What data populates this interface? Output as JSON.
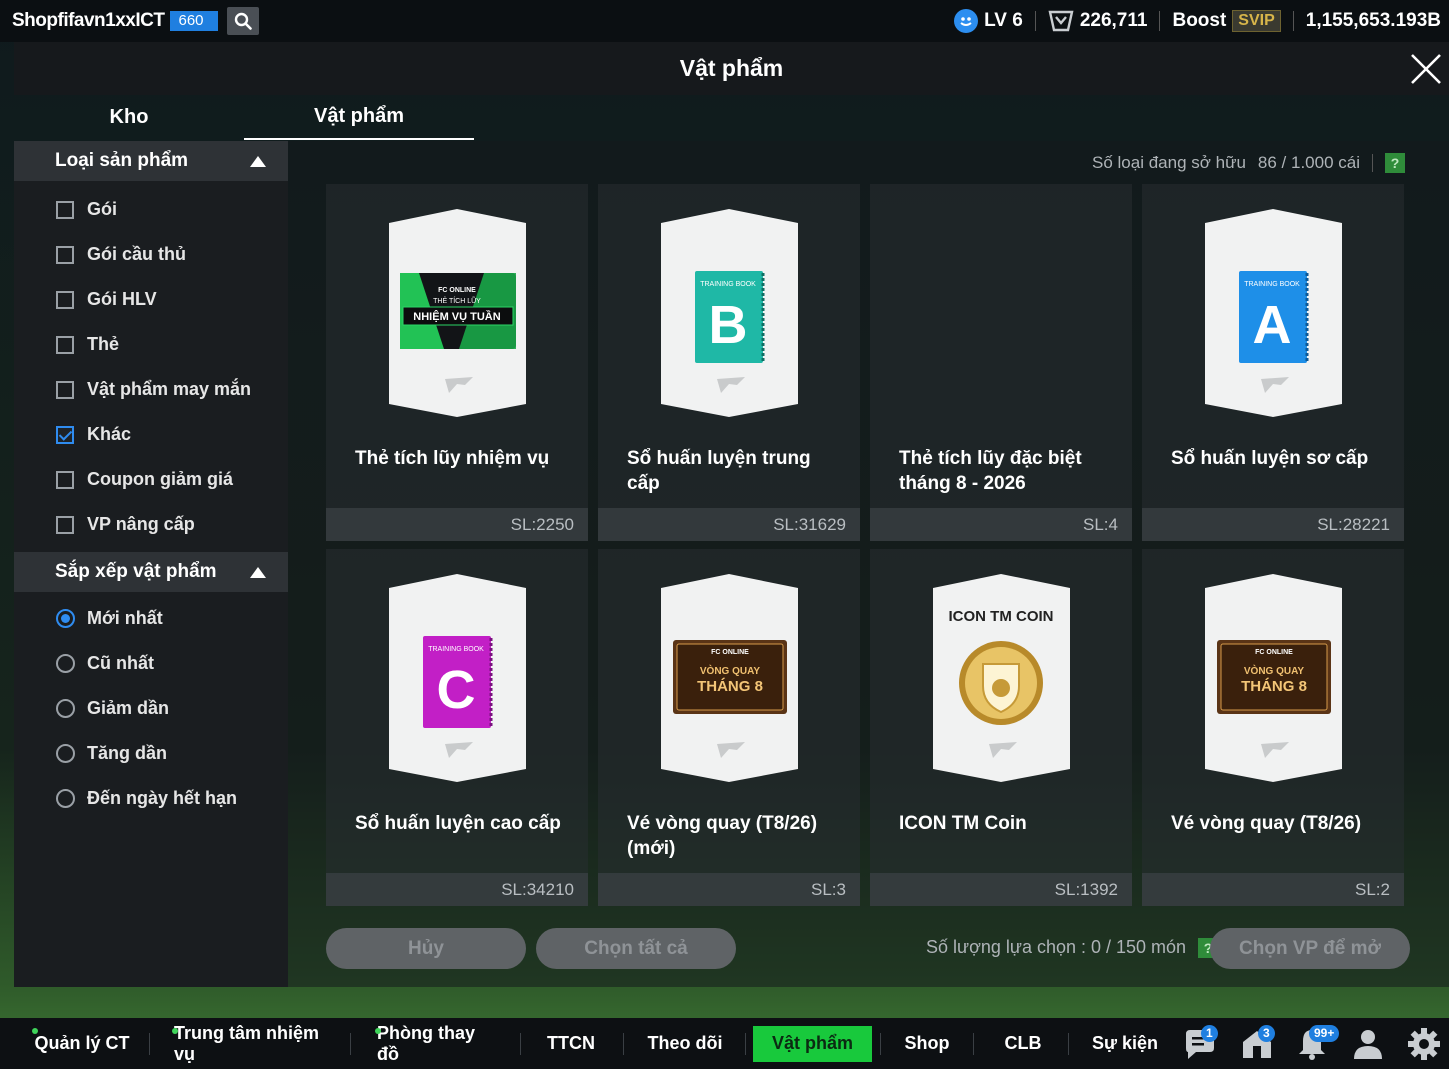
{
  "topbar": {
    "username": "Shopfifavn1xxICT",
    "ovr_badge": "660",
    "level": "LV 6",
    "points": "226,711",
    "boost_label": "Boost",
    "svip_label": "SVIP",
    "balance": "1,155,653.193B"
  },
  "modal": {
    "title": "Vật phẩm",
    "tabs": [
      {
        "label": "Kho",
        "active": false
      },
      {
        "label": "Vật phẩm",
        "active": true
      }
    ]
  },
  "sidebar": {
    "product_type_header": "Loại sản phẩm",
    "product_types": [
      {
        "label": "Gói",
        "checked": false
      },
      {
        "label": "Gói cầu thủ",
        "checked": false
      },
      {
        "label": "Gói HLV",
        "checked": false
      },
      {
        "label": "Thẻ",
        "checked": false
      },
      {
        "label": "Vật phẩm may mắn",
        "checked": false
      },
      {
        "label": "Khác",
        "checked": true
      },
      {
        "label": "Coupon giảm giá",
        "checked": false
      },
      {
        "label": "VP nâng cấp",
        "checked": false
      }
    ],
    "sort_header": "Sắp xếp vật phẩm",
    "sort_options": [
      {
        "label": "Mới nhất",
        "checked": true
      },
      {
        "label": "Cũ nhất",
        "checked": false
      },
      {
        "label": "Giảm dần",
        "checked": false
      },
      {
        "label": "Tăng dần",
        "checked": false
      },
      {
        "label": "Đến ngày hết hạn",
        "checked": false
      }
    ]
  },
  "content": {
    "owned_label": "Số loại đang sở hữu",
    "owned_value": "86 / 1.000 cái",
    "help": "?",
    "items": [
      {
        "name": "Thẻ tích lũy nhiệm vụ",
        "qty": "SL:2250",
        "art": "mission-card",
        "art_text": [
          "FC ONLINE",
          "THẺ TÍCH LŨY",
          "NHIỆM VỤ TUẦN"
        ]
      },
      {
        "name": "Sổ huấn luyện trung cấp",
        "qty": "SL:31629",
        "art": "book",
        "art_text": [
          "TRAINING BOOK",
          "B"
        ],
        "color": "#1fb8a6"
      },
      {
        "name": "Thẻ tích lũy đặc biệt tháng 8 - 2026",
        "qty": "SL:4",
        "art": "none",
        "art_text": []
      },
      {
        "name": "Sổ huấn luyện sơ cấp",
        "qty": "SL:28221",
        "art": "book",
        "art_text": [
          "TRAINING BOOK",
          "A"
        ],
        "color": "#1e8fe8"
      },
      {
        "name": "Sổ huấn luyện cao cấp",
        "qty": "SL:34210",
        "art": "book",
        "art_text": [
          "TRAINING BOOK",
          "C"
        ],
        "color": "#c21fc6"
      },
      {
        "name": "Vé vòng quay (T8/26) (mới)",
        "qty": "SL:3",
        "art": "ticket",
        "art_text": [
          "FC ONLINE",
          "VÒNG QUAY",
          "THÁNG 8"
        ]
      },
      {
        "name": "ICON TM Coin",
        "qty": "SL:1392",
        "art": "coin",
        "art_text": [
          "ICON TM COIN"
        ]
      },
      {
        "name": "Vé vòng quay (T8/26)",
        "qty": "SL:2",
        "art": "ticket",
        "art_text": [
          "FC ONLINE",
          "VÒNG QUAY",
          "THÁNG 8"
        ]
      }
    ],
    "cancel_label": "Hủy",
    "select_all_label": "Chọn tất cả",
    "selection_text": "Số lượng lựa chọn : 0 / 150 món",
    "open_label": "Chọn VP để mở"
  },
  "bottom_nav": {
    "items": [
      {
        "label": "Quản lý CT",
        "dot": true,
        "active": false
      },
      {
        "label": "Trung tâm nhiệm vụ",
        "dot": true,
        "active": false
      },
      {
        "label": "Phòng thay đồ",
        "dot": true,
        "active": false
      },
      {
        "label": "TTCN",
        "dot": false,
        "active": false
      },
      {
        "label": "Theo dõi",
        "dot": false,
        "active": false
      },
      {
        "label": "Vật phẩm",
        "dot": false,
        "active": true
      },
      {
        "label": "Shop",
        "dot": false,
        "active": false
      },
      {
        "label": "CLB",
        "dot": false,
        "active": false
      },
      {
        "label": "Sự kiện",
        "dot": false,
        "active": false
      }
    ],
    "icons": [
      {
        "icon": "chat-icon",
        "badge": "1"
      },
      {
        "icon": "home-flag-icon",
        "badge": "3"
      },
      {
        "icon": "bell-icon",
        "badge": "99+"
      },
      {
        "icon": "profile-icon",
        "badge": ""
      },
      {
        "icon": "gear-icon",
        "badge": ""
      }
    ]
  },
  "colors": {
    "accent_green": "#18c93c",
    "accent_blue": "#1f7fe0"
  }
}
